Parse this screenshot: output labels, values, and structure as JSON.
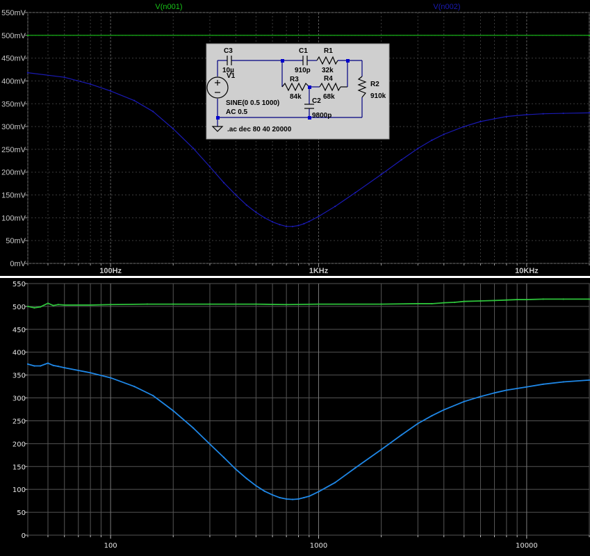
{
  "colors": {
    "v_n001": "#18c418",
    "v_n002_top": "#1a1ab4",
    "v_n002_bottom": "#1f87e6",
    "plot_bg": "#000000",
    "bottom_green": "#2ec23b"
  },
  "legend": {
    "v_n001": "V(n001)",
    "v_n002": "V(n002)"
  },
  "schematic": {
    "c3": "C3",
    "c3_value": "10µ",
    "c1": "C1",
    "c1_value": "910p",
    "r1": "R1",
    "r1_value": "32k",
    "r3": "R3",
    "r3_value": "84k",
    "r4": "R4",
    "r4_value": "68k",
    "r2": "R2",
    "r2_value": "910k",
    "c2": "C2",
    "c2_value": "9800p",
    "v1": "V1",
    "v1_sine": "SINE(0 0.5 1000)",
    "v1_ac": "AC 0.5",
    "directive": ".ac dec 80 40 20000"
  },
  "chart_data": [
    {
      "type": "line",
      "x_scale": "log",
      "xlim": [
        40,
        20000
      ],
      "ylim": [
        0,
        550
      ],
      "y_ticks": [
        "0mV",
        "50mV",
        "100mV",
        "150mV",
        "200mV",
        "250mV",
        "300mV",
        "350mV",
        "400mV",
        "450mV",
        "500mV",
        "550mV"
      ],
      "x_ticks": [
        "100Hz",
        "1KHz",
        "10KHz"
      ],
      "grid": true,
      "legend_placement": "top",
      "series": [
        {
          "name": "V(n001)",
          "color": "#18c418",
          "x": [
            40,
            20000
          ],
          "y": [
            500,
            500
          ]
        },
        {
          "name": "V(n002)",
          "color": "#1a1ab4",
          "x": [
            40,
            60,
            80,
            100,
            130,
            160,
            200,
            250,
            300,
            350,
            400,
            450,
            500,
            550,
            600,
            650,
            700,
            750,
            800,
            850,
            900,
            1000,
            1200,
            1500,
            2000,
            2500,
            3000,
            3500,
            4000,
            5000,
            6000,
            7000,
            8000,
            10000,
            12000,
            15000,
            20000
          ],
          "y": [
            418,
            408,
            393,
            378,
            357,
            333,
            295,
            252,
            212,
            177,
            150,
            128,
            112,
            100,
            91,
            85,
            81,
            81,
            83,
            87,
            92,
            103,
            125,
            155,
            195,
            227,
            252,
            270,
            283,
            300,
            311,
            317,
            322,
            326,
            328,
            329,
            330
          ]
        }
      ]
    },
    {
      "type": "line",
      "x_scale": "log",
      "xlim": [
        40,
        20000
      ],
      "ylim": [
        0,
        550
      ],
      "y_ticks": [
        "0",
        "50",
        "100",
        "150",
        "200",
        "250",
        "300",
        "350",
        "400",
        "450",
        "500",
        "550"
      ],
      "x_ticks": [
        "100",
        "1000",
        "10000"
      ],
      "grid": true,
      "series": [
        {
          "color": "#2ec23b",
          "x": [
            40,
            43,
            46,
            50,
            53,
            56,
            60,
            70,
            80,
            100,
            150,
            200,
            300,
            500,
            700,
            1000,
            2000,
            3000,
            3500,
            4000,
            4500,
            5000,
            6000,
            7000,
            8000,
            9000,
            10000,
            12000,
            15000,
            20000
          ],
          "y": [
            500,
            497,
            499,
            507,
            502,
            504,
            503,
            503,
            503,
            504,
            505,
            505,
            505,
            505,
            504,
            505,
            505,
            506,
            506,
            508,
            509,
            511,
            512,
            513,
            514,
            515,
            515,
            516,
            516,
            516
          ]
        },
        {
          "color": "#1f87e6",
          "x": [
            40,
            43,
            46,
            50,
            53,
            56,
            60,
            80,
            100,
            130,
            160,
            200,
            250,
            300,
            350,
            400,
            450,
            500,
            550,
            600,
            650,
            700,
            750,
            800,
            850,
            900,
            1000,
            1200,
            1500,
            2000,
            2500,
            3000,
            3500,
            4000,
            5000,
            6000,
            7000,
            8000,
            10000,
            12000,
            15000,
            20000
          ],
          "y": [
            374,
            370,
            370,
            376,
            371,
            369,
            366,
            355,
            344,
            325,
            305,
            272,
            234,
            199,
            170,
            144,
            124,
            108,
            96,
            88,
            82,
            79,
            78,
            79,
            82,
            85,
            95,
            115,
            147,
            187,
            219,
            244,
            261,
            274,
            292,
            303,
            311,
            317,
            324,
            330,
            335,
            339
          ]
        }
      ]
    }
  ]
}
